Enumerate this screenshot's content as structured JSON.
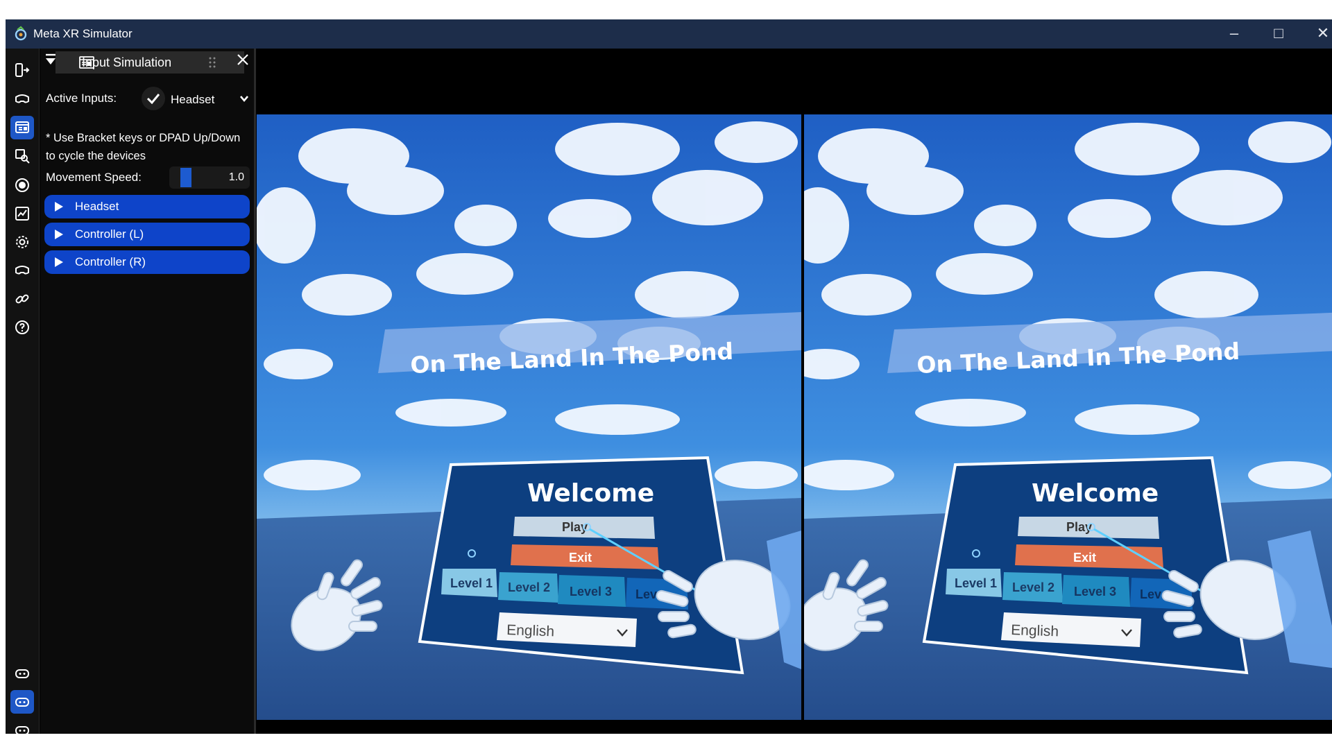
{
  "window": {
    "title": "Meta XR Simulator",
    "minimize": "–",
    "maximize": "□",
    "close": "✕"
  },
  "rail": {
    "items": [
      {
        "name": "device-icon"
      },
      {
        "name": "headset-icon"
      },
      {
        "name": "input-simulation-icon",
        "active": true
      },
      {
        "name": "scene-search-icon"
      },
      {
        "name": "record-icon"
      },
      {
        "name": "graph-icon"
      },
      {
        "name": "gear-icon"
      },
      {
        "name": "headset-alt-icon"
      },
      {
        "name": "link-icon"
      },
      {
        "name": "help-icon"
      },
      {
        "name": "controller-icon"
      },
      {
        "name": "controller-active-icon",
        "active": true
      },
      {
        "name": "controller-alt-icon"
      }
    ]
  },
  "panel": {
    "title": "Input Simulation",
    "active_inputs_label": "Active Inputs:",
    "active_inputs_value": "Headset",
    "hint": "* Use Bracket keys or DPAD Up/Down to cycle the devices",
    "speed_label": "Movement Speed:",
    "speed_value": "1.0",
    "sections": [
      "Headset",
      "Controller (L)",
      "Controller (R)"
    ]
  },
  "scene": {
    "banner": "On The Land In The Pond",
    "welcome": "Welcome",
    "play": "Play",
    "exit": "Exit",
    "levels": [
      "Level 1",
      "Level 2",
      "Level 3",
      "Lev"
    ],
    "language": "English"
  },
  "colors": {
    "accent": "#1e57c6",
    "section_blue": "#0e44c9",
    "menu_panel": "#0d3f80",
    "exit_button": "#e0714d",
    "play_button": "#c7d7e5",
    "level_button": "#3aa3cf",
    "sky": "#2d6fd0",
    "floor": "#2f5f9e"
  }
}
